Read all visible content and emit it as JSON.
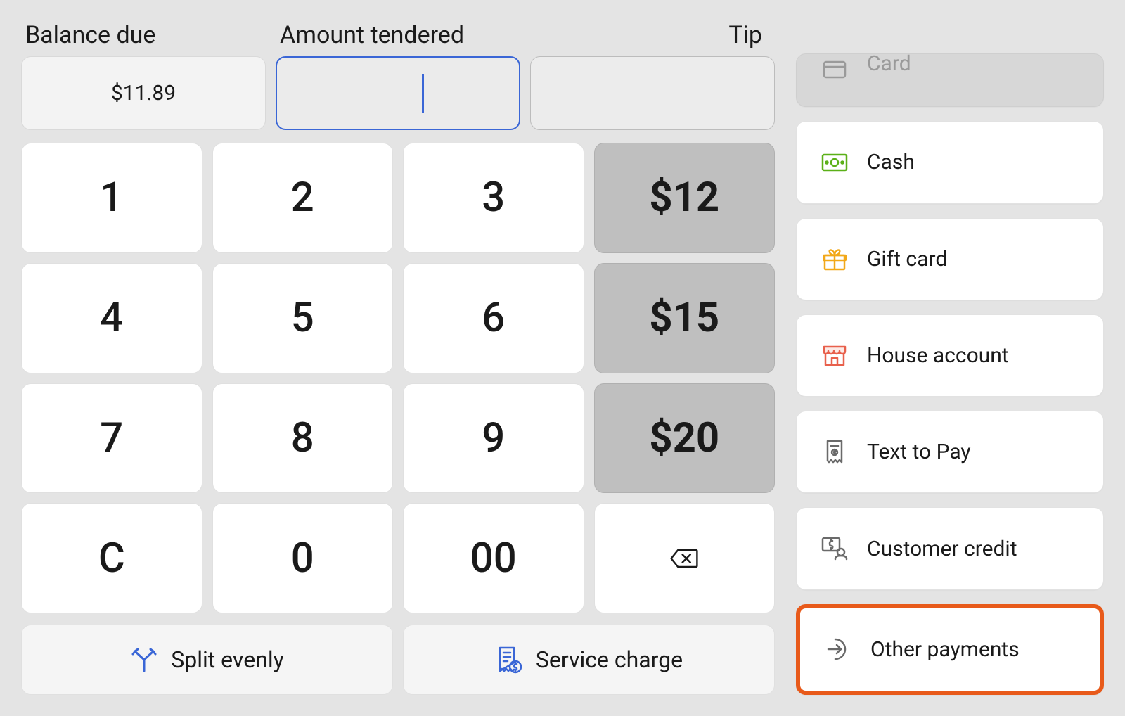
{
  "header": {
    "balance_label": "Balance due",
    "balance_value": "$11.89",
    "tendered_label": "Amount tendered",
    "tendered_value": "",
    "tip_label": "Tip",
    "tip_value": ""
  },
  "keypad": {
    "keys": [
      "1",
      "2",
      "3",
      "4",
      "5",
      "6",
      "7",
      "8",
      "9",
      "C",
      "0",
      "00"
    ],
    "quick": [
      "$12",
      "$15",
      "$20"
    ]
  },
  "actions": {
    "split_label": "Split evenly",
    "service_label": "Service charge"
  },
  "payments": {
    "card": "Card",
    "cash": "Cash",
    "gift": "Gift card",
    "house": "House account",
    "text": "Text to Pay",
    "credit": "Customer credit",
    "other": "Other payments"
  }
}
